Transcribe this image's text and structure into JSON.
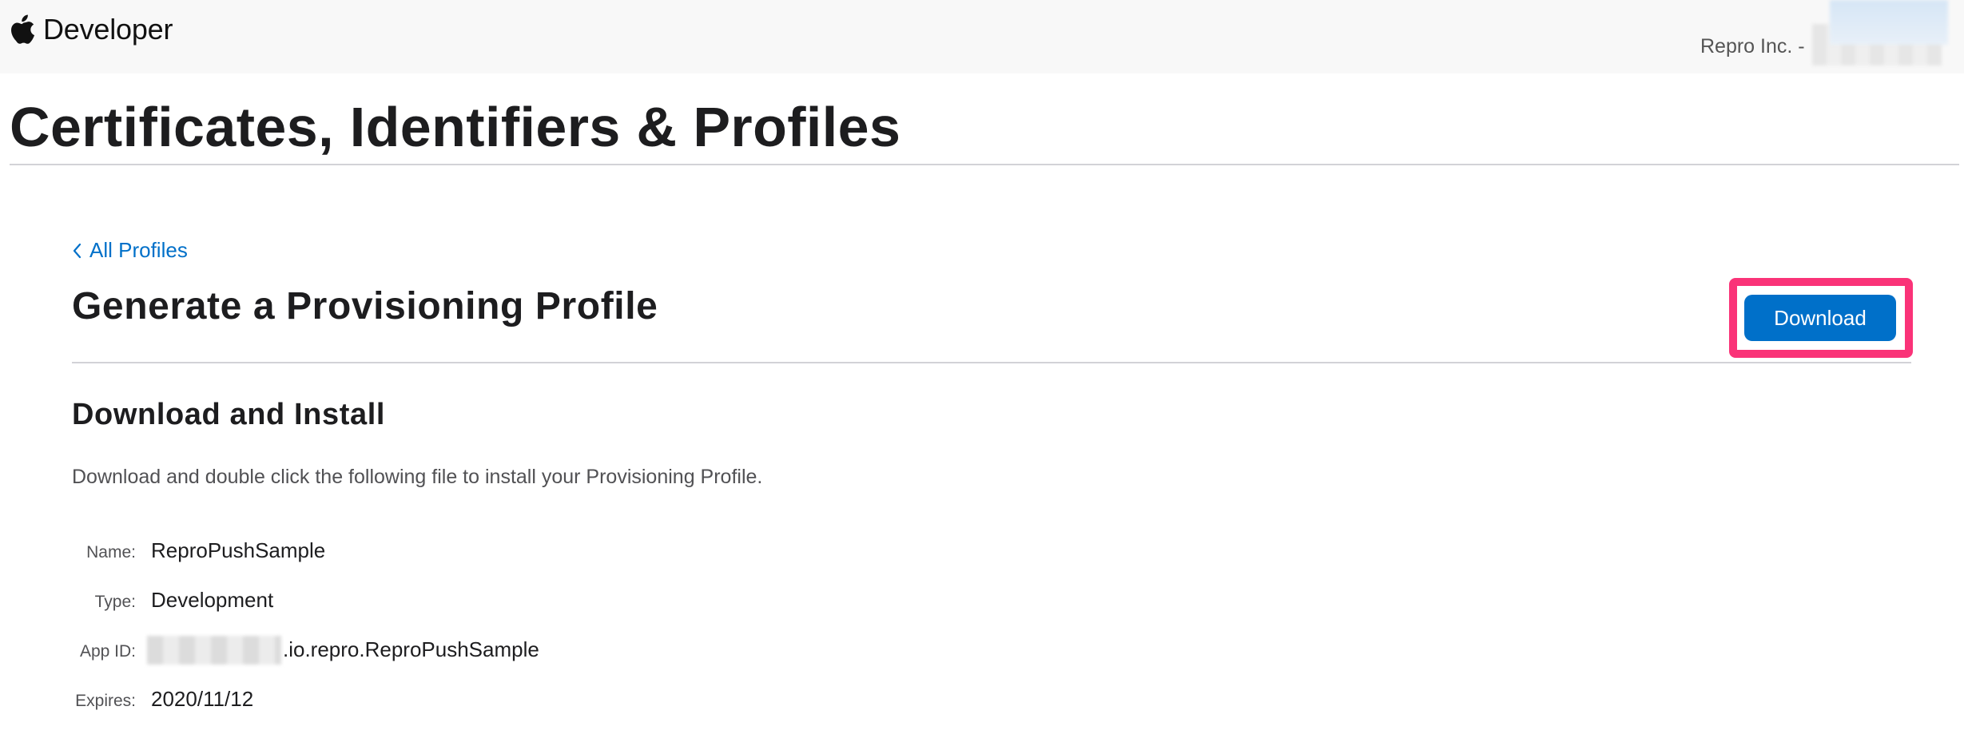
{
  "header": {
    "brand_label": "Developer",
    "account_label": "Repro Inc. -"
  },
  "page": {
    "title": "Certificates, Identifiers & Profiles"
  },
  "breadcrumb": {
    "back_label": "All Profiles"
  },
  "section": {
    "title": "Generate a Provisioning Profile",
    "download_label": "Download"
  },
  "install": {
    "title": "Download and Install",
    "instructions": "Download and double click the following file to install your Provisioning Profile."
  },
  "details": {
    "name_label": "Name:",
    "name_value": "ReproPushSample",
    "type_label": "Type:",
    "type_value": "Development",
    "appid_label": "App ID:",
    "appid_suffix": ".io.repro.ReproPushSample",
    "expires_label": "Expires:",
    "expires_value": "2020/11/12"
  },
  "colors": {
    "accent": "#0070c9",
    "highlight": "#fa3378",
    "topbar_bg": "#f8f8f8"
  },
  "icons": {
    "brand": "apple-logo-icon",
    "back": "chevron-left-icon"
  }
}
